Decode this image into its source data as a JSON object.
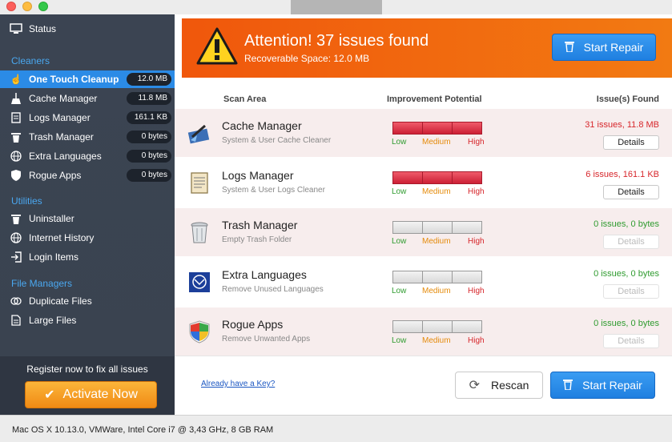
{
  "sidebar": {
    "status_label": "Status",
    "sections": {
      "cleaners": "Cleaners",
      "utilities": "Utilities",
      "file_managers": "File Managers"
    },
    "cleaners": [
      {
        "label": "One Touch Cleanup",
        "badge": "12.0 MB",
        "icon": "hand-pointer-icon",
        "active": true
      },
      {
        "label": "Cache Manager",
        "badge": "11.8 MB",
        "icon": "broom-icon"
      },
      {
        "label": "Logs Manager",
        "badge": "161.1 KB",
        "icon": "document-icon"
      },
      {
        "label": "Trash Manager",
        "badge": "0 bytes",
        "icon": "trash-icon"
      },
      {
        "label": "Extra Languages",
        "badge": "0 bytes",
        "icon": "globe-icon"
      },
      {
        "label": "Rogue Apps",
        "badge": "0 bytes",
        "icon": "shield-icon"
      }
    ],
    "utilities": [
      {
        "label": "Uninstaller",
        "icon": "trash-icon"
      },
      {
        "label": "Internet History",
        "icon": "globe-icon"
      },
      {
        "label": "Login Items",
        "icon": "login-icon"
      }
    ],
    "file_managers": [
      {
        "label": "Duplicate Files",
        "icon": "duplicate-icon"
      },
      {
        "label": "Large Files",
        "icon": "file-icon"
      }
    ],
    "register_text": "Register now to fix all issues",
    "activate_label": "Activate Now"
  },
  "banner": {
    "title": "Attention! 37 issues found",
    "subtitle": "Recoverable Space: 12.0 MB",
    "repair_label": "Start Repair"
  },
  "table": {
    "headers": {
      "scan_area": "Scan Area",
      "improvement": "Improvement Potential",
      "issues": "Issue(s) Found"
    },
    "level_labels": {
      "low": "Low",
      "medium": "Medium",
      "high": "High"
    },
    "details_label": "Details",
    "rows": [
      {
        "name": "Cache Manager",
        "desc": "System & User Cache Cleaner",
        "issues": "31 issues, 11.8 MB",
        "level": "high"
      },
      {
        "name": "Logs Manager",
        "desc": "System & User Logs Cleaner",
        "issues": "6 issues, 161.1 KB",
        "level": "high"
      },
      {
        "name": "Trash Manager",
        "desc": "Empty Trash Folder",
        "issues": "0 issues, 0 bytes",
        "level": "none"
      },
      {
        "name": "Extra Languages",
        "desc": "Remove Unused Languages",
        "issues": "0 issues, 0 bytes",
        "level": "none"
      },
      {
        "name": "Rogue Apps",
        "desc": "Remove Unwanted Apps",
        "issues": "0 issues, 0 bytes",
        "level": "none"
      }
    ]
  },
  "footer": {
    "key_link": "Already have a Key?",
    "rescan_label": "Rescan",
    "repair_label": "Start Repair"
  },
  "statusbar": {
    "text": "Mac OS X 10.13.0, VMWare, Intel Core i7 @ 3,43 GHz, 8 GB RAM"
  },
  "colors": {
    "sidebar_bg": "#3b4452",
    "accent_blue": "#2b8be6",
    "banner_orange": "#f0570c",
    "activate_orange": "#f08a14",
    "issue_red": "#d7262b",
    "issue_green": "#2f9b2f"
  }
}
